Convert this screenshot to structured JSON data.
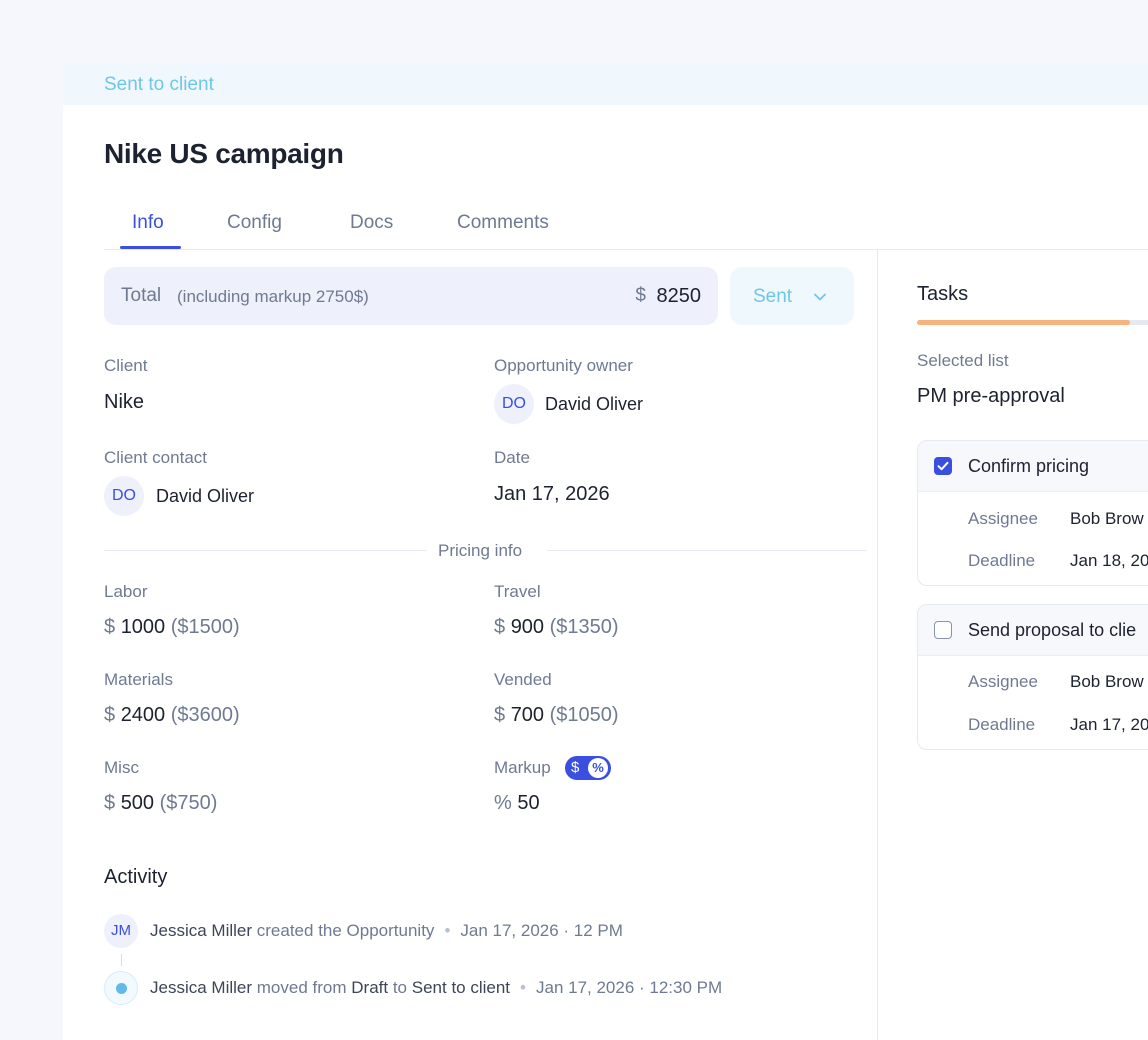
{
  "status": {
    "label": "Sent to client"
  },
  "opportunity": {
    "title": "Nike US campaign"
  },
  "tabs": [
    {
      "label": "Info",
      "active": true
    },
    {
      "label": "Config",
      "active": false
    },
    {
      "label": "Docs",
      "active": false
    },
    {
      "label": "Comments",
      "active": false
    }
  ],
  "total": {
    "label": "Total",
    "note": "(including markup 2750$)",
    "currency": "$",
    "value": "8250"
  },
  "status_dropdown": {
    "label": "Sent",
    "icon": "chevron-down-icon"
  },
  "details": {
    "client_label": "Client",
    "client_value": "Nike",
    "owner_label": "Opportunity owner",
    "owner_initials": "DO",
    "owner_name": "David Oliver",
    "contact_label": "Client contact",
    "contact_initials": "DO",
    "contact_name": "David Oliver",
    "date_label": "Date",
    "date_value": "Jan 17, 2026"
  },
  "pricing": {
    "section_label": "Pricing info",
    "currency": "$",
    "items": [
      {
        "label": "Labor",
        "value": "1000",
        "total": "($1500)"
      },
      {
        "label": "Travel",
        "value": "900",
        "total": "($1350)"
      },
      {
        "label": "Materials",
        "value": "2400",
        "total": "($3600)"
      },
      {
        "label": "Vended",
        "value": "700",
        "total": "($1050)"
      },
      {
        "label": "Misc",
        "value": "500",
        "total": "($750)"
      }
    ],
    "markup": {
      "label": "Markup",
      "toggle_left": "$",
      "toggle_right": "%",
      "unit": "%",
      "value": "50"
    }
  },
  "activity": {
    "heading": "Activity",
    "entries": [
      {
        "initials": "JM",
        "actor": "Jessica Miller",
        "action": "created the Opportunity",
        "time": "Jan 17, 2026 · 12 PM"
      },
      {
        "actor": "Jessica Miller",
        "action_1": "moved from",
        "from": "Draft",
        "action_2": "to",
        "to": "Sent to client",
        "time": "Jan 17, 2026 · 12:30 PM"
      }
    ]
  },
  "tasks": {
    "title": "Tasks",
    "progress": 0.82,
    "selected_list_label": "Selected list",
    "selected_list_value": "PM pre-approval",
    "assignee_label": "Assignee",
    "deadline_label": "Deadline",
    "items": [
      {
        "name": "Confirm pricing",
        "checked": true,
        "assignee": "Bob Brow",
        "deadline": "Jan 18, 20"
      },
      {
        "name": "Send proposal to clie",
        "checked": false,
        "assignee": "Bob Brow",
        "deadline": "Jan 17, 20"
      }
    ]
  },
  "colors": {
    "accent": "#3a4fe0",
    "status_cyan": "#6fc6e6",
    "progress": "#f5b47e",
    "muted_text": "#6f7a91"
  }
}
